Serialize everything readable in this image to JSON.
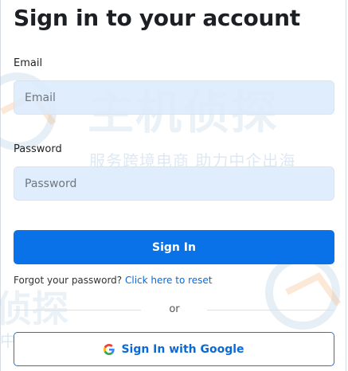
{
  "page": {
    "title": "Sign in to your account"
  },
  "form": {
    "email_label": "Email",
    "email_placeholder": "Email",
    "email_value": "",
    "password_label": "Password",
    "password_placeholder": "Password",
    "password_value": "",
    "submit_label": "Sign In",
    "forgot_text": "Forgot your password?",
    "forgot_link": "Click here to reset",
    "divider_text": "or",
    "google_label": "Sign In with Google",
    "google_icon": "google-g-icon"
  },
  "watermark": {
    "brand_large": "主机侦探",
    "slogan": "服务跨境电商 助力中企出海",
    "brand_large_partial": "侦探",
    "slogan_partial": "中企出海"
  },
  "colors": {
    "primary": "#0a72e8",
    "link": "#0a6ad6",
    "input_bg": "#dbeafb",
    "title": "#1c1f24"
  }
}
